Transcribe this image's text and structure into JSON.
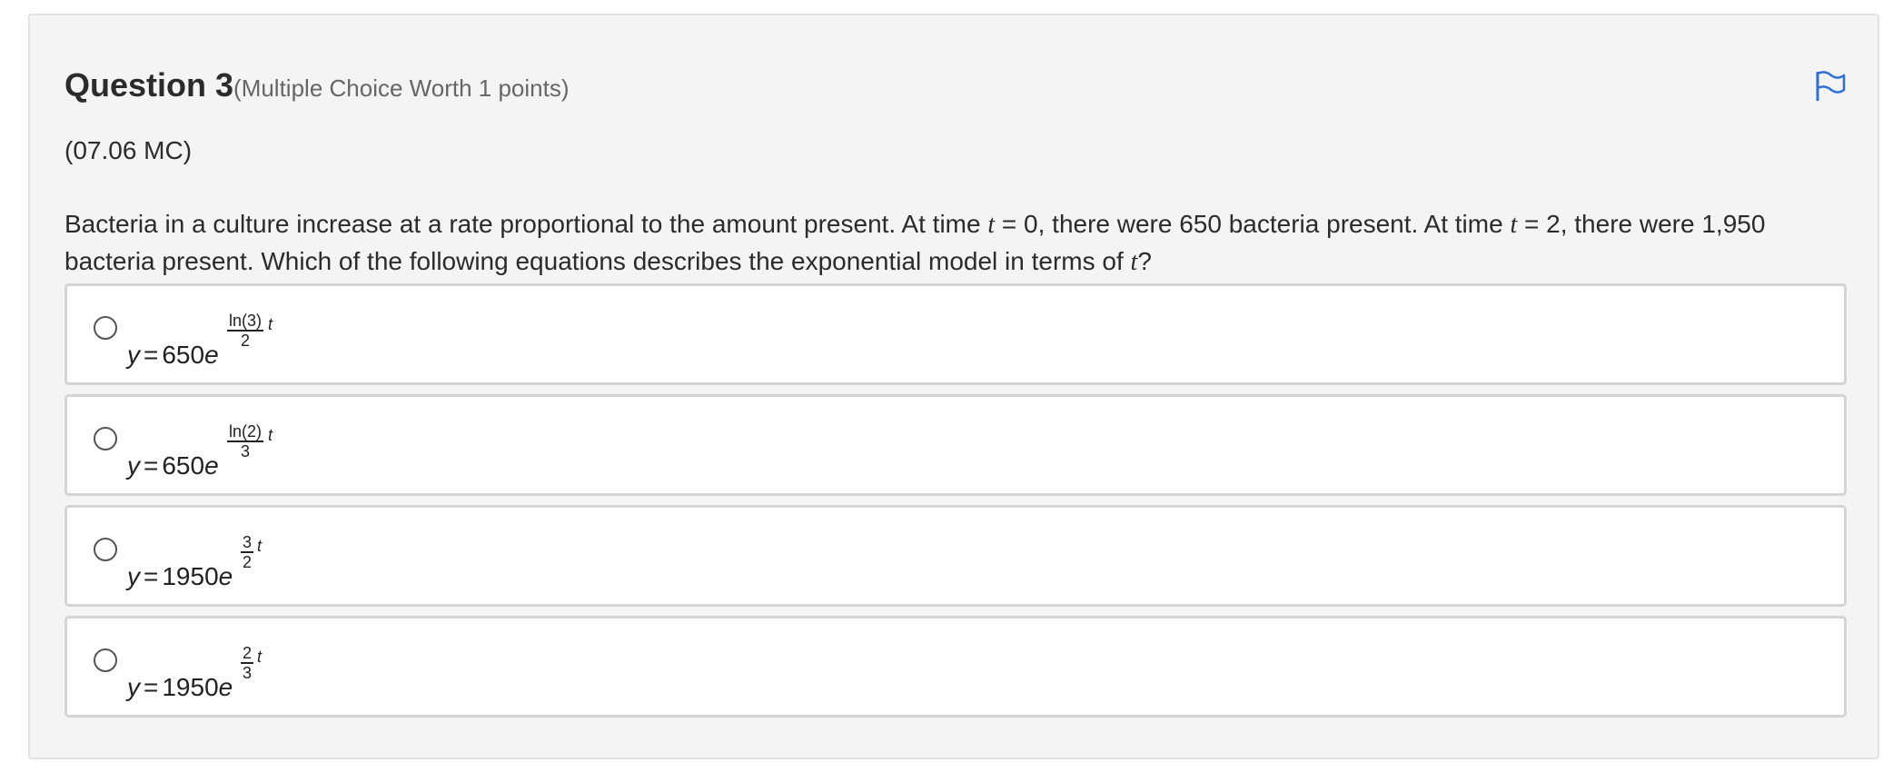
{
  "question": {
    "title": "Question 3",
    "meta": "(Multiple Choice Worth 1 points)",
    "code": "(07.06 MC)",
    "text": {
      "part1": "Bacteria in a culture increase at a rate proportional to the amount present. At time ",
      "var1": "t",
      "part2": " = 0, there were 650 bacteria present. At time ",
      "var2": "t",
      "part3": " = 2, there were 1,950 bacteria present. Which of the following equations describes the exponential model in terms of ",
      "var3": "t",
      "part4": "?"
    }
  },
  "flag_icon": "flag-icon",
  "accent_color": "#2f6fd6",
  "options": [
    {
      "y": "y",
      "eq": "=",
      "coef": "650",
      "e": "e",
      "num": "ln(3)",
      "den": "2",
      "t": "t"
    },
    {
      "y": "y",
      "eq": "=",
      "coef": "650",
      "e": "e",
      "num": "ln(2)",
      "den": "3",
      "t": "t"
    },
    {
      "y": "y",
      "eq": "=",
      "coef": "1950",
      "e": "e",
      "num": "3",
      "den": "2",
      "t": "t"
    },
    {
      "y": "y",
      "eq": "=",
      "coef": "1950",
      "e": "e",
      "num": "2",
      "den": "3",
      "t": "t"
    }
  ]
}
